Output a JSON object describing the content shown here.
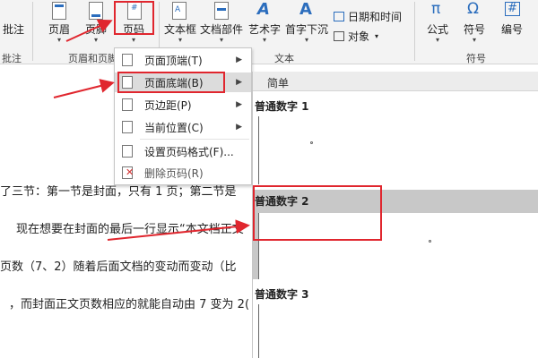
{
  "ribbon": {
    "buttons": {
      "comment": "批注",
      "header": "页眉",
      "footer": "页脚",
      "page_number": "页码",
      "text_box": "文本框",
      "quick_parts": "文档部件",
      "wordart": "艺术字",
      "drop_cap": "首字下沉",
      "date_time": "日期和时间",
      "object": "对象",
      "equation": "公式",
      "symbol": "符号",
      "numbering": "编号"
    },
    "groups": {
      "comments": "批注",
      "header_footer": "页眉和页脚",
      "text": "文本",
      "symbols": "符号"
    }
  },
  "menu": {
    "items": [
      {
        "label": "页面顶端(T)",
        "has_submenu": true
      },
      {
        "label": "页面底端(B)",
        "has_submenu": true
      },
      {
        "label": "页边距(P)",
        "has_submenu": true
      },
      {
        "label": "当前位置(C)",
        "has_submenu": true
      },
      {
        "label": "设置页码格式(F)...",
        "has_submenu": false
      },
      {
        "label": "删除页码(R)",
        "has_submenu": false
      }
    ]
  },
  "gallery": {
    "header": "简单",
    "sections": [
      {
        "title": "普通数字 1",
        "sample": "0"
      },
      {
        "title": "普通数字 2",
        "sample": "0"
      },
      {
        "title": "普通数字 3",
        "sample": ""
      }
    ]
  },
  "document": {
    "lines": [
      "了三节：第一节是封面，只有 1 页；第二节是",
      "现在想要在封面的最后一行显示“本文档正文",
      "页数（7、2）随着后面文档的变动而变动（比",
      "，而封面正文页数相应的就能自动由 7 变为 2("
    ]
  },
  "colors": {
    "highlight": "#e0262e",
    "accent_blue": "#2b6dbd",
    "ribbon_bg": "#f3f3f3",
    "active_item": "#dcdcdc"
  }
}
